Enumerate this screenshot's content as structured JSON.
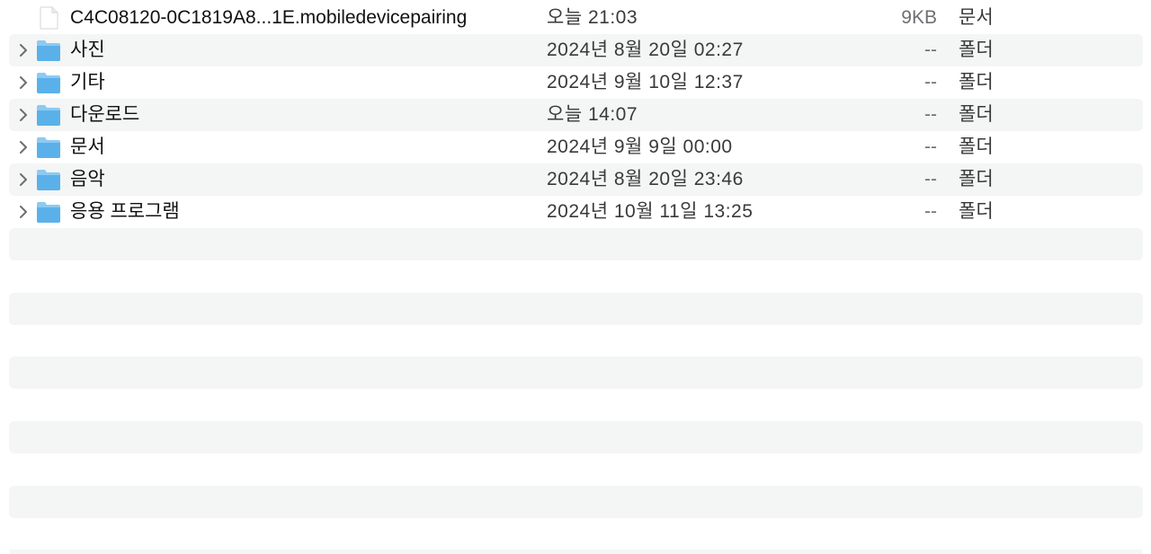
{
  "rows": [
    {
      "type": "file",
      "name": "C4C08120-0C1819A8...1E.mobiledevicepairing",
      "date": "오늘 21:03",
      "size": "9KB",
      "kind": "문서",
      "icon": "document-icon"
    },
    {
      "type": "folder",
      "name": "사진",
      "date": "2024년 8월 20일 02:27",
      "size": "--",
      "kind": "폴더",
      "icon": "folder-icon"
    },
    {
      "type": "folder",
      "name": "기타",
      "date": "2024년 9월 10일 12:37",
      "size": "--",
      "kind": "폴더",
      "icon": "folder-icon"
    },
    {
      "type": "folder",
      "name": "다운로드",
      "date": "오늘 14:07",
      "size": "--",
      "kind": "폴더",
      "icon": "folder-icon"
    },
    {
      "type": "folder",
      "name": "문서",
      "date": "2024년 9월 9일 00:00",
      "size": "--",
      "kind": "폴더",
      "icon": "folder-icon"
    },
    {
      "type": "folder",
      "name": "음악",
      "date": "2024년 8월 20일 23:46",
      "size": "--",
      "kind": "폴더",
      "icon": "folder-icon"
    },
    {
      "type": "folder",
      "name": "응용 프로그램",
      "date": "2024년 10월 11일 13:25",
      "size": "--",
      "kind": "폴더",
      "icon": "folder-icon"
    }
  ],
  "colors": {
    "stripe": "#f4f5f5",
    "folder_front": "#5ab1ea",
    "folder_back": "#8ccaf2",
    "chevron": "#6e6e73"
  }
}
